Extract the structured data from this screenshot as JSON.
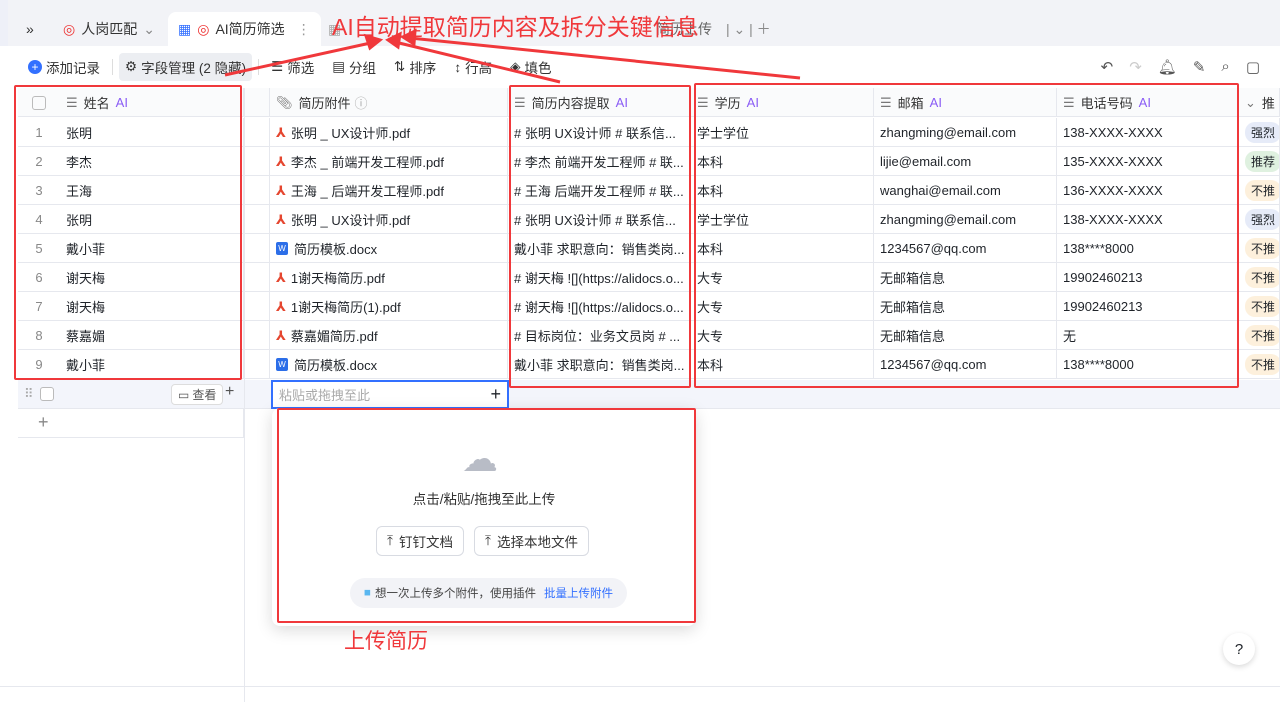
{
  "tabs": [
    {
      "label": "人岗匹配"
    },
    {
      "label": "AI简历筛选"
    },
    {
      "label": "简历上传"
    }
  ],
  "toolbar": {
    "add": "添加记录",
    "fields": "字段管理 (2 隐藏)",
    "filter": "筛选",
    "group": "分组",
    "sort": "排序",
    "row_height": "行高",
    "fill": "填色"
  },
  "columns": {
    "name": "姓名",
    "attach": "简历附件",
    "extract": "简历内容提取",
    "edu": "学历",
    "email": "邮箱",
    "phone": "电话号码",
    "rec": "推",
    "ai": "AI"
  },
  "rows": [
    {
      "i": "1",
      "name": "张明",
      "file": "张明 _ UX设计师.pdf",
      "type": "pdf",
      "extract": "# 张明 UX设计师 # 联系信...",
      "edu": "学士学位",
      "email": "zhangming@email.com",
      "phone": "138-XXXX-XXXX",
      "rec": "强烈",
      "recColor": "#e6ebf8"
    },
    {
      "i": "2",
      "name": "李杰",
      "file": "李杰 _ 前端开发工程师.pdf",
      "type": "pdf",
      "extract": "# 李杰 前端开发工程师 # 联...",
      "edu": "本科",
      "email": "lijie@email.com",
      "phone": "135-XXXX-XXXX",
      "rec": "推荐",
      "recColor": "#dff1e0"
    },
    {
      "i": "3",
      "name": "王海",
      "file": "王海 _ 后端开发工程师.pdf",
      "type": "pdf",
      "extract": "# 王海 后端开发工程师 # 联...",
      "edu": "本科",
      "email": "wanghai@email.com",
      "phone": "136-XXXX-XXXX",
      "rec": "不推",
      "recColor": "#fdf0dc"
    },
    {
      "i": "4",
      "name": "张明",
      "file": "张明 _ UX设计师.pdf",
      "type": "pdf",
      "extract": "# 张明 UX设计师 # 联系信...",
      "edu": "学士学位",
      "email": "zhangming@email.com",
      "phone": "138-XXXX-XXXX",
      "rec": "强烈",
      "recColor": "#e6ebf8"
    },
    {
      "i": "5",
      "name": "戴小菲",
      "file": "简历模板.docx",
      "type": "docx",
      "extract": "戴小菲 求职意向：销售类岗...",
      "edu": "本科",
      "email": "1234567@qq.com",
      "phone": "138****8000",
      "rec": "不推",
      "recColor": "#fdf0dc"
    },
    {
      "i": "6",
      "name": "谢天梅",
      "file": "1谢天梅简历.pdf",
      "type": "pdf",
      "extract": "# 谢天梅 ![](https://alidocs.o...",
      "edu": "大专",
      "email": "无邮箱信息",
      "phone": "19902460213",
      "rec": "不推",
      "recColor": "#fdf0dc"
    },
    {
      "i": "7",
      "name": "谢天梅",
      "file": "1谢天梅简历(1).pdf",
      "type": "pdf",
      "extract": "# 谢天梅 ![](https://alidocs.o...",
      "edu": "大专",
      "email": "无邮箱信息",
      "phone": "19902460213",
      "rec": "不推",
      "recColor": "#fdf0dc"
    },
    {
      "i": "8",
      "name": "蔡嘉媚",
      "file": "蔡嘉媚简历.pdf",
      "type": "pdf",
      "extract": "# 目标岗位：业务文员岗 # ...",
      "edu": "大专",
      "email": "无邮箱信息",
      "phone": "无",
      "rec": "不推",
      "recColor": "#fdf0dc"
    },
    {
      "i": "9",
      "name": "戴小菲",
      "file": "简历模板.docx",
      "type": "docx",
      "extract": "戴小菲 求职意向：销售类岗...",
      "edu": "本科",
      "email": "1234567@qq.com",
      "phone": "138****8000",
      "rec": "不推",
      "recColor": "#fdf0dc"
    }
  ],
  "new_row": {
    "view": "查看",
    "placeholder": "粘贴或拖拽至此"
  },
  "upload": {
    "hint": "点击/粘贴/拖拽至此上传",
    "dingtalk": "钉钉文档",
    "local": "选择本地文件",
    "tip": "想一次上传多个附件，使用插件",
    "tip_link": "批量上传附件"
  },
  "annotations": {
    "top": "AI自动提取简历内容及拆分关键信息",
    "bottom": "上传简历"
  },
  "help": "?"
}
